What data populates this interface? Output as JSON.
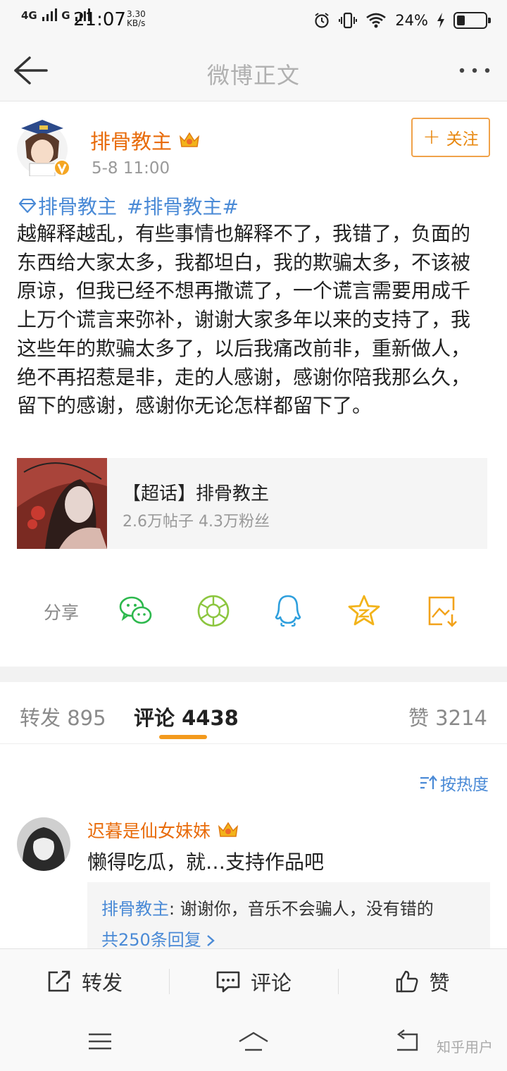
{
  "status_bar": {
    "network": "4G",
    "network2": "G",
    "time": "21:07",
    "speed_value": "3.30",
    "speed_unit": "KB/s",
    "battery": "24%",
    "battery_level": 0.24
  },
  "nav": {
    "title": "微博正文"
  },
  "post": {
    "author": "排骨教主",
    "time": "5-8 11:00",
    "follow_label": "关注",
    "tags": [
      "排骨教主",
      "#排骨教主#"
    ],
    "body": "越解释越乱，有些事情也解释不了，我错了，负面的东西给大家太多，我都坦白，我的欺骗太多，不该被原谅，但我已经不想再撒谎了，一个谎言需要用成千上万个谎言来弥补，谢谢大家多年以来的支持了，我这些年的欺骗太多了，以后我痛改前非，重新做人，绝不再招惹是非，走的人感谢，感谢你陪我那么久，留下的感谢，感谢你无论怎样都留下了。",
    "topic_card": {
      "title": "【超话】排骨教主",
      "stats": "2.6万帖子 4.3万粉丝"
    }
  },
  "share": {
    "label": "分享",
    "targets": [
      "wechat-icon",
      "moments-icon",
      "qq-icon",
      "qzone-icon",
      "save-image-icon"
    ]
  },
  "tabs": {
    "repost": "转发 895",
    "comment": "评论 4438",
    "like": "赞 3214"
  },
  "sort_label": "按热度",
  "comment": {
    "author": "迟暮是仙女妹妹",
    "text": "懒得吃瓜，就…支持作品吧",
    "reply_author": "排骨教主",
    "reply_text": ": 谢谢你，音乐不会骗人，没有错的",
    "reply_more": "共250条回复 "
  },
  "actions": {
    "repost": "转发",
    "comment": "评论",
    "like": "赞"
  },
  "watermark": "知乎用户",
  "colors": {
    "brand_orange": "#e86b0a",
    "link_blue": "#4a8ad6",
    "tab_indicator": "#f39a1d"
  }
}
